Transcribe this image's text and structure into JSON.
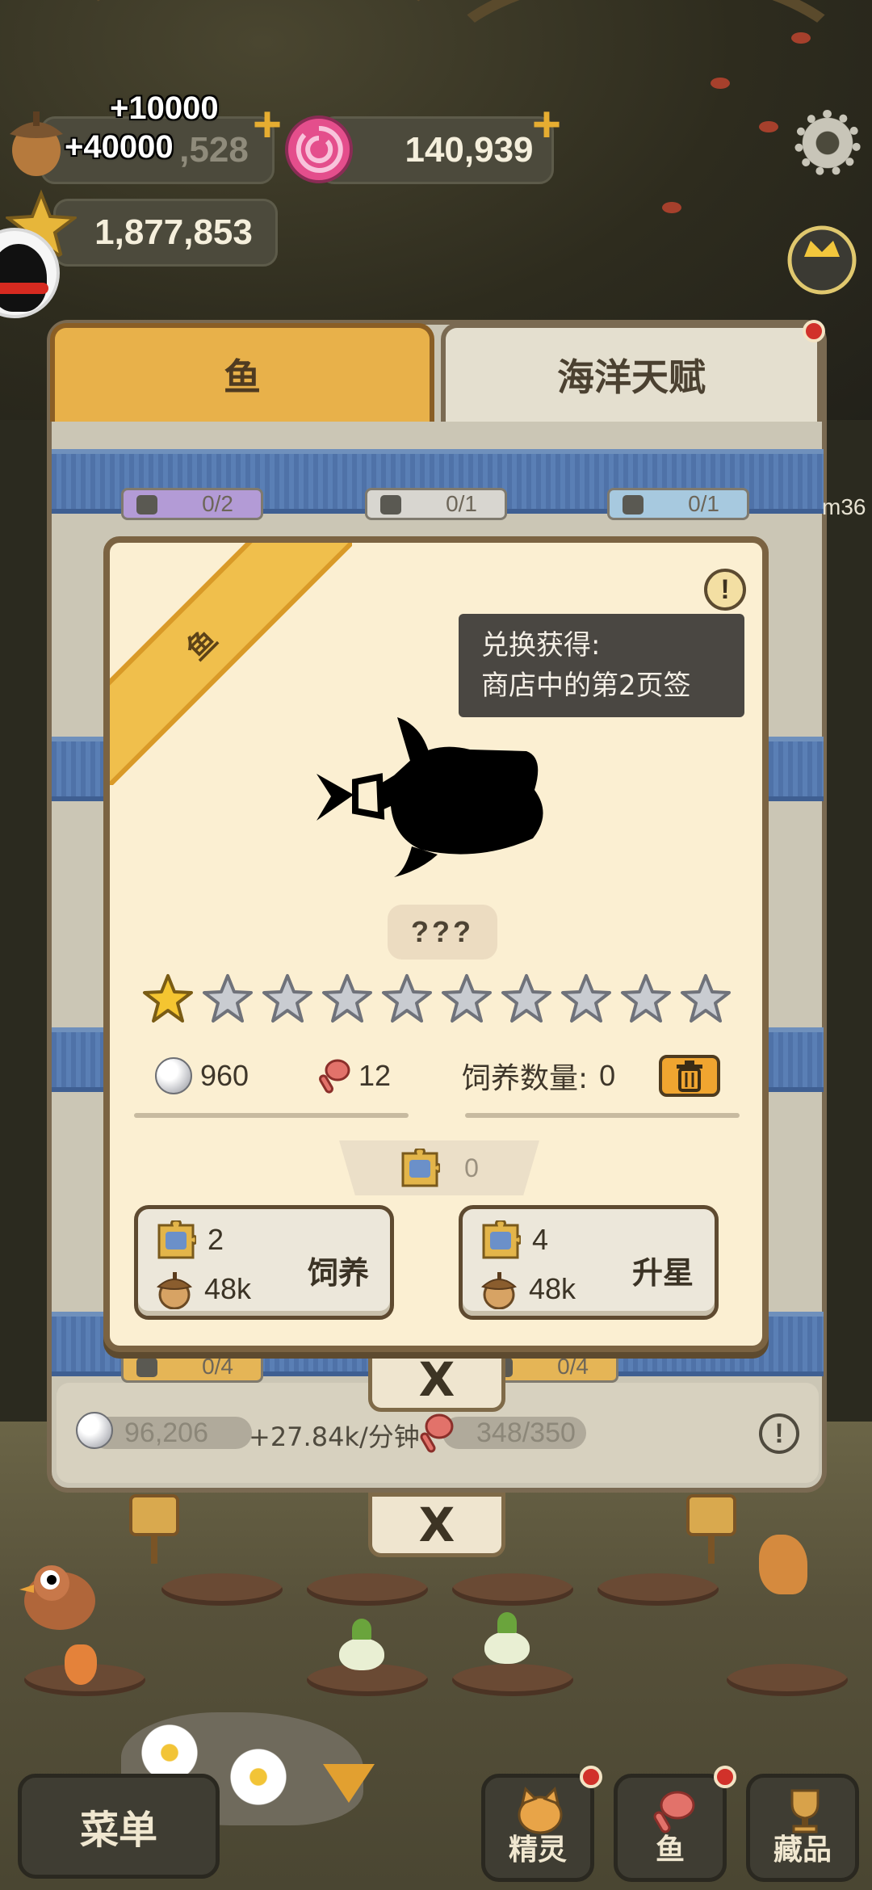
{
  "hud": {
    "acorn_value": ",528",
    "candy_value": "140,939",
    "star_value": "1,877,853",
    "gain_1": "+10000",
    "gain_2": "+40000"
  },
  "tabs": {
    "fish": "鱼",
    "ocean_talent": "海洋天赋"
  },
  "counters": {
    "top": [
      "0/2",
      "0/1",
      "0/1"
    ],
    "bottom": [
      "0/4",
      "0/4"
    ]
  },
  "side_text": "m36",
  "footer": {
    "pearls": "96,206",
    "rate": "+27.84k/分钟",
    "capacity": "348/350",
    "info": "!"
  },
  "close_label": "X",
  "modal": {
    "ribbon_label": "鱼",
    "info_symbol": "!",
    "tooltip": {
      "line1": "兑换获得:",
      "line2": "商店中的第2页签"
    },
    "fish_name": "???",
    "stars_filled": 1,
    "stars_total": 10,
    "pearl_value": "960",
    "feed_value": "12",
    "feed_count_label": "饲养数量:",
    "feed_count_value": "0",
    "shard_count": "0",
    "feed_button": {
      "pieces": "2",
      "acorns": "48k",
      "label": "饲养"
    },
    "upgrade_button": {
      "pieces": "4",
      "acorns": "48k",
      "label": "升星"
    }
  },
  "bottom_nav": {
    "menu": "菜单",
    "spirit": "精灵",
    "fish": "鱼",
    "collection": "藏品"
  },
  "colors": {
    "accent_gold": "#e8b14a",
    "ribbon": "#f0bf4c",
    "modal_bg": "#fbefd2",
    "band_blue": "#4f72a8"
  }
}
